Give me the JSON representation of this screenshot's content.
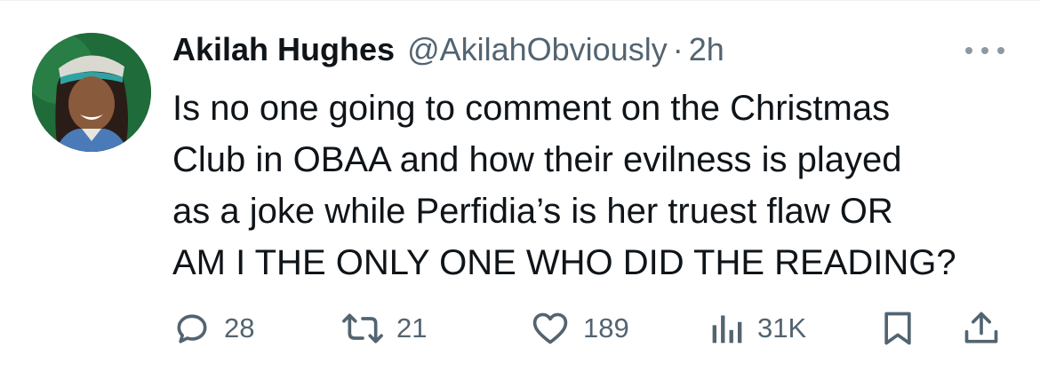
{
  "author": {
    "display_name": "Akilah Hughes",
    "handle": "@AkilahObviously",
    "separator": "·",
    "time": "2h"
  },
  "tweet": {
    "lines": [
      "Is no one going to comment on the Christmas",
      "Club in OBAA and how their evilness is played",
      "as a joke while Perfidia’s is her truest flaw OR",
      "AM I THE ONLY ONE WHO DID THE READING?"
    ]
  },
  "actions": {
    "replies": "28",
    "reposts": "21",
    "likes": "189",
    "views": "31K"
  },
  "icons": {
    "reply": "reply-icon",
    "repost": "repost-icon",
    "like": "heart-icon",
    "views": "views-icon",
    "bookmark": "bookmark-icon",
    "share": "share-icon",
    "more": "more-icon"
  },
  "colors": {
    "text": "#0f1419",
    "secondary": "#536471",
    "avatar_bg": "#1f6b3a"
  }
}
